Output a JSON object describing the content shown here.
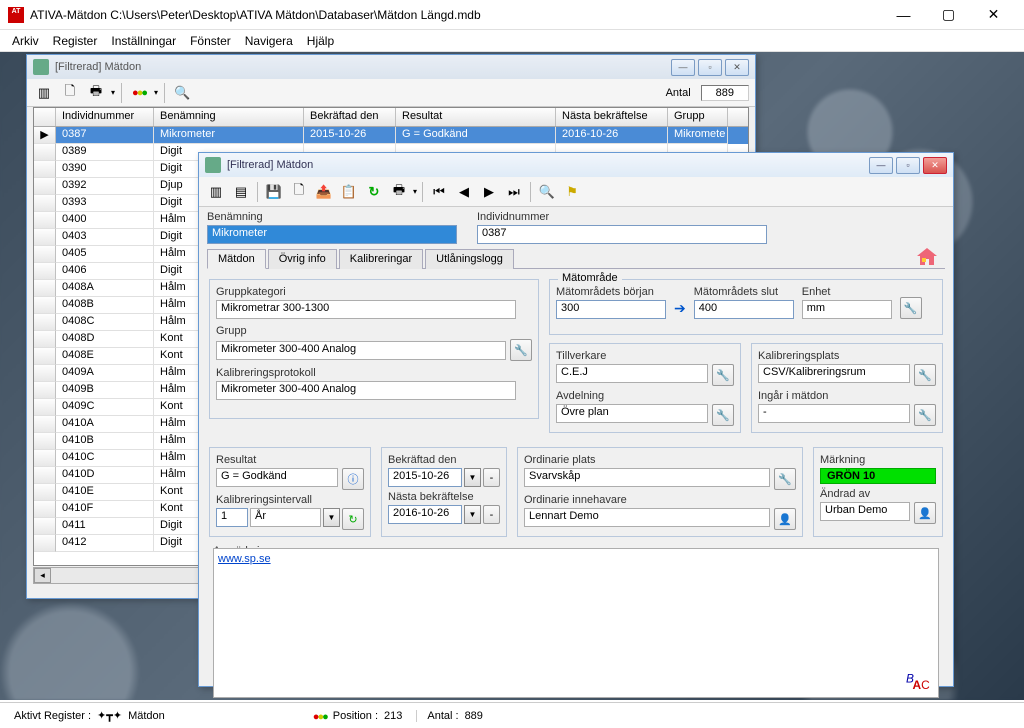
{
  "app_title": "ATIVA-Mätdon C:\\Users\\Peter\\Desktop\\ATIVA Mätdon\\Databaser\\Mätdon Längd.mdb",
  "menu": [
    "Arkiv",
    "Register",
    "Inställningar",
    "Fönster",
    "Navigera",
    "Hjälp"
  ],
  "grid_win": {
    "title": "[Filtrerad] Mätdon",
    "antal_label": "Antal",
    "antal_value": "889",
    "cols": [
      "Individnummer",
      "Benämning",
      "Bekräftad den",
      "Resultat",
      "Nästa bekräftelse",
      "Grupp"
    ],
    "selected_row": [
      "0387",
      "Mikrometer",
      "2015-10-26",
      "G = Godkänd",
      "2016-10-26",
      "Mikromete"
    ],
    "rows": [
      [
        "0389",
        "Digit"
      ],
      [
        "0390",
        "Digit"
      ],
      [
        "0392",
        "Djup"
      ],
      [
        "0393",
        "Digit"
      ],
      [
        "0400",
        "Hålm"
      ],
      [
        "0403",
        "Digit"
      ],
      [
        "0405",
        "Hålm"
      ],
      [
        "0406",
        "Digit"
      ],
      [
        "0408A",
        "Hålm"
      ],
      [
        "0408B",
        "Hålm"
      ],
      [
        "0408C",
        "Hålm"
      ],
      [
        "0408D",
        "Kont"
      ],
      [
        "0408E",
        "Kont"
      ],
      [
        "0409A",
        "Hålm"
      ],
      [
        "0409B",
        "Hålm"
      ],
      [
        "0409C",
        "Kont"
      ],
      [
        "0410A",
        "Hålm"
      ],
      [
        "0410B",
        "Hålm"
      ],
      [
        "0410C",
        "Hålm"
      ],
      [
        "0410D",
        "Hålm"
      ],
      [
        "0410E",
        "Kont"
      ],
      [
        "0410F",
        "Kont"
      ],
      [
        "0411",
        "Digit"
      ],
      [
        "0412",
        "Digit"
      ]
    ]
  },
  "detail_win": {
    "title": "[Filtrerad] Mätdon",
    "benamning_label": "Benämning",
    "benamning_value": "Mikrometer",
    "individ_label": "Individnummer",
    "individ_value": "0387",
    "tabs": [
      "Mätdon",
      "Övrig info",
      "Kalibreringar",
      "Utlåningslogg"
    ],
    "gruppkat_label": "Gruppkategori",
    "gruppkat_value": "Mikrometrar 300-1300",
    "grupp_label": "Grupp",
    "grupp_value": "Mikrometer 300-400 Analog",
    "kalpro_label": "Kalibreringsprotokoll",
    "kalpro_value": "Mikrometer 300-400 Analog",
    "matomr_label": "Mätområde",
    "mb_label": "Mätområdets början",
    "mb_value": "300",
    "ms_label": "Mätområdets slut",
    "ms_value": "400",
    "enhet_label": "Enhet",
    "enhet_value": "mm",
    "tillv_label": "Tillverkare",
    "tillv_value": "C.E.J",
    "avd_label": "Avdelning",
    "avd_value": "Övre plan",
    "kalplats_label": "Kalibreringsplats",
    "kalplats_value": "CSV/Kalibreringsrum",
    "ingar_label": "Ingår i mätdon",
    "ingar_value": "-",
    "resultat_label": "Resultat",
    "resultat_value": "G = Godkänd",
    "kalint_label": "Kalibreringsintervall",
    "kalint_num": "1",
    "kalint_unit": "År",
    "bekr_label": "Bekräftad den",
    "bekr_value": "2015-10-26",
    "nasta_label": "Nästa bekräftelse",
    "nasta_value": "2016-10-26",
    "ordplats_label": "Ordinarie plats",
    "ordplats_value": "Svarvskåp",
    "ordinn_label": "Ordinarie innehavare",
    "ordinn_value": "Lennart Demo",
    "mark_label": "Märkning",
    "mark_value": "GRÖN 10",
    "andrad_label": "Ändrad av",
    "andrad_value": "Urban Demo",
    "anm_label": "Anmärkningar",
    "anm_link": "www.sp.se"
  },
  "status": {
    "aktivt_label": "Aktivt Register :",
    "aktivt_value": "Mätdon",
    "pos_label": "Position :",
    "pos_value": "213",
    "antal_label": "Antal :",
    "antal_value": "889"
  }
}
